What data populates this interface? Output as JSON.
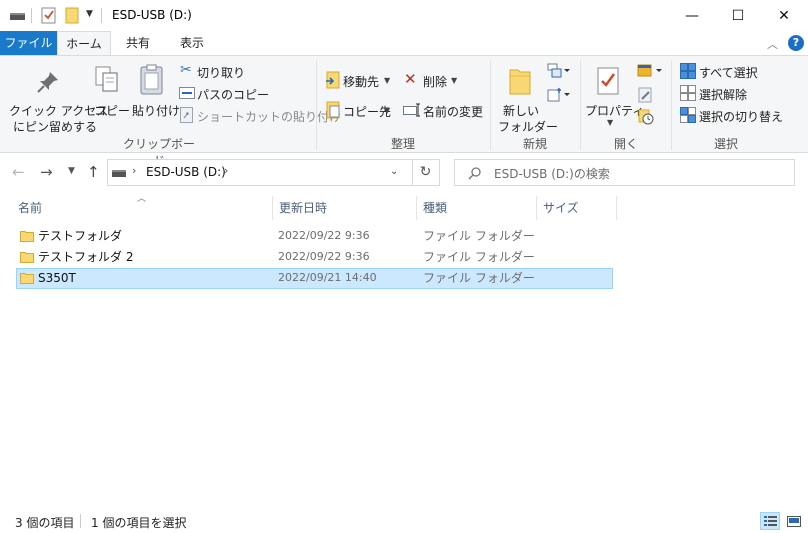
{
  "window": {
    "title": "ESD-USB (D:)",
    "minimize_glyph": "—",
    "maximize_glyph": "☐",
    "close_glyph": "✕"
  },
  "tabs": [
    {
      "label": "ファイル"
    },
    {
      "label": "ホーム"
    },
    {
      "label": "共有"
    },
    {
      "label": "表示"
    }
  ],
  "ribbon": {
    "clipboard": {
      "pin_label_1": "クイック アクセス",
      "pin_label_2": "にピン留めする",
      "copy_label": "コピー",
      "paste_label": "貼り付け",
      "cut_label": "切り取り",
      "copy_path_label": "パスのコピー",
      "paste_shortcut_label": "ショートカットの貼り付け",
      "group_label": "クリップボード"
    },
    "organize": {
      "move_to_label": "移動先",
      "copy_to_label": "コピー先",
      "delete_label": "削除",
      "rename_label": "名前の変更",
      "group_label": "整理"
    },
    "new": {
      "new_folder_label_1": "新しい",
      "new_folder_label_2": "フォルダー",
      "group_label": "新規"
    },
    "open": {
      "properties_label": "プロパティ",
      "group_label": "開く"
    },
    "select": {
      "select_all_label": "すべて選択",
      "select_none_label": "選択解除",
      "invert_label": "選択の切り替え",
      "group_label": "選択"
    }
  },
  "address": {
    "path_segment": "ESD-USB (D:)",
    "search_placeholder": "ESD-USB (D:)の検索"
  },
  "columns": {
    "name": "名前",
    "date": "更新日時",
    "type": "種類",
    "size": "サイズ"
  },
  "files": [
    {
      "name": "テストフォルダ",
      "date": "2022/09/22 9:36",
      "type": "ファイル フォルダー"
    },
    {
      "name": "テストフォルダ 2",
      "date": "2022/09/22 9:36",
      "type": "ファイル フォルダー"
    },
    {
      "name": "S350T",
      "date": "2022/09/21 14:40",
      "type": "ファイル フォルダー"
    }
  ],
  "status": {
    "item_count": "3 個の項目",
    "selected_count": "1 個の項目を選択"
  },
  "colors": {
    "file_tab": "#1979ca",
    "selection": "#cce8ff",
    "folder": "#f8d775"
  }
}
